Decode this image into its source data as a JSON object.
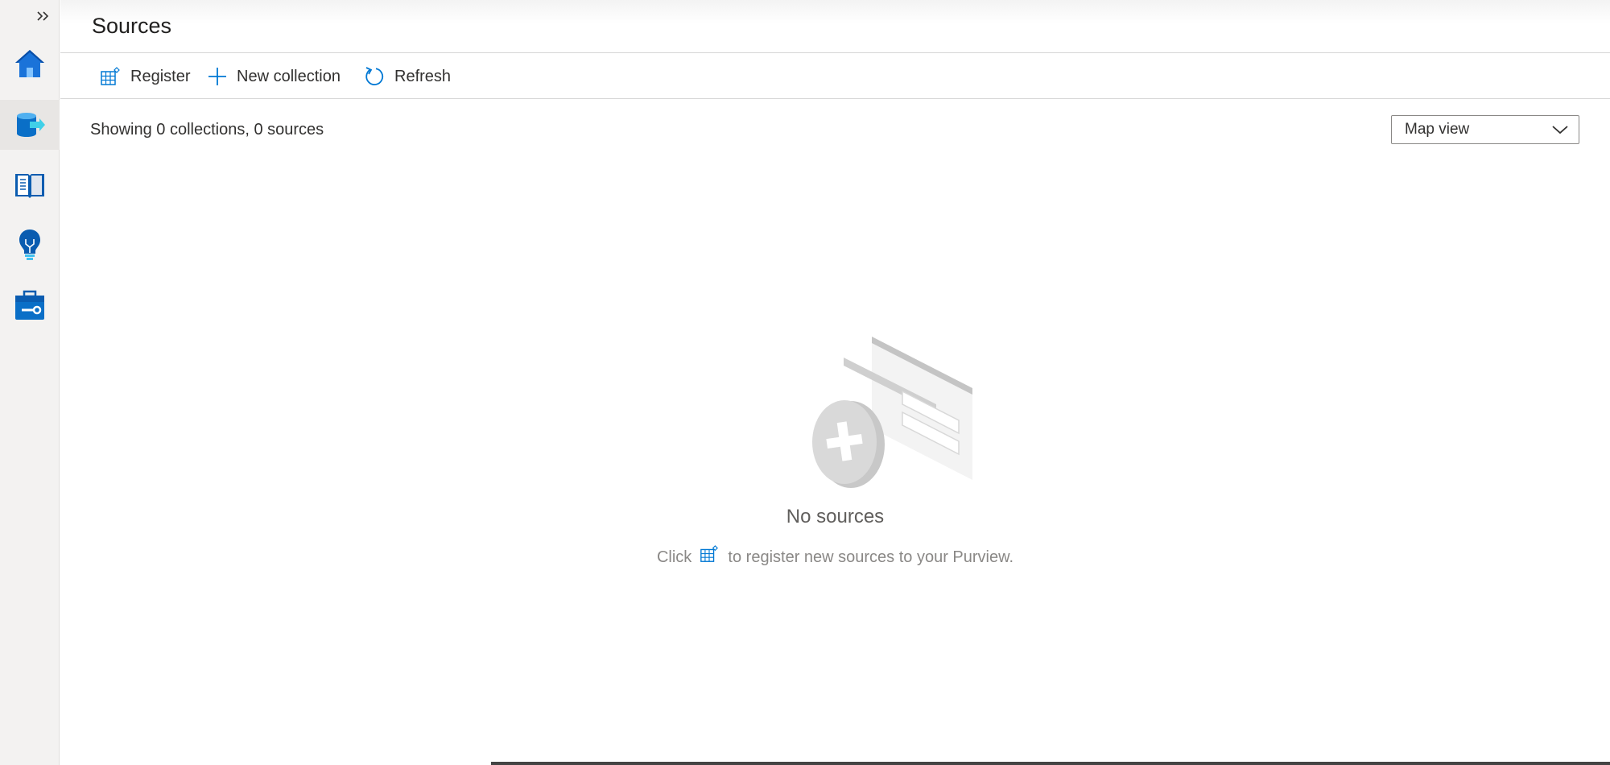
{
  "header": {
    "title": "Sources"
  },
  "toolbar": {
    "register_label": "Register",
    "new_collection_label": "New collection",
    "refresh_label": "Refresh"
  },
  "summary": {
    "text": "Showing 0 collections, 0 sources"
  },
  "view_select": {
    "selected": "Map view"
  },
  "empty_state": {
    "title": "No sources",
    "hint_prefix": "Click",
    "hint_suffix": "to register new sources to your Purview."
  },
  "sidebar": {
    "items": [
      {
        "icon": "home-icon"
      },
      {
        "icon": "data-map-icon"
      },
      {
        "icon": "catalog-book-icon"
      },
      {
        "icon": "insights-bulb-icon"
      },
      {
        "icon": "management-toolbox-icon"
      }
    ]
  },
  "colors": {
    "accent": "#0078d4",
    "rail_bg": "#f3f2f1",
    "text": "#323130",
    "muted_text": "#8a8886"
  }
}
